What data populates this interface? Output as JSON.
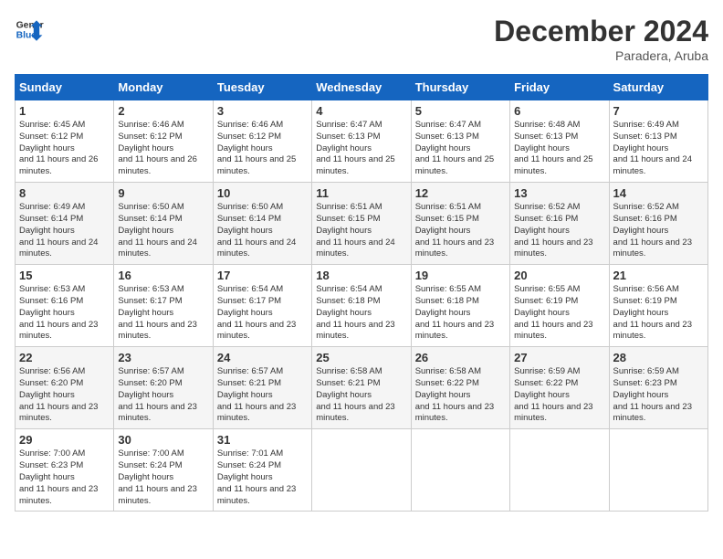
{
  "logo": {
    "line1": "General",
    "line2": "Blue"
  },
  "title": "December 2024",
  "location": "Paradera, Aruba",
  "days_of_week": [
    "Sunday",
    "Monday",
    "Tuesday",
    "Wednesday",
    "Thursday",
    "Friday",
    "Saturday"
  ],
  "weeks": [
    [
      {
        "day": "1",
        "sunrise": "6:45 AM",
        "sunset": "6:12 PM",
        "daylight": "11 hours and 26 minutes."
      },
      {
        "day": "2",
        "sunrise": "6:46 AM",
        "sunset": "6:12 PM",
        "daylight": "11 hours and 26 minutes."
      },
      {
        "day": "3",
        "sunrise": "6:46 AM",
        "sunset": "6:12 PM",
        "daylight": "11 hours and 25 minutes."
      },
      {
        "day": "4",
        "sunrise": "6:47 AM",
        "sunset": "6:13 PM",
        "daylight": "11 hours and 25 minutes."
      },
      {
        "day": "5",
        "sunrise": "6:47 AM",
        "sunset": "6:13 PM",
        "daylight": "11 hours and 25 minutes."
      },
      {
        "day": "6",
        "sunrise": "6:48 AM",
        "sunset": "6:13 PM",
        "daylight": "11 hours and 25 minutes."
      },
      {
        "day": "7",
        "sunrise": "6:49 AM",
        "sunset": "6:13 PM",
        "daylight": "11 hours and 24 minutes."
      }
    ],
    [
      {
        "day": "8",
        "sunrise": "6:49 AM",
        "sunset": "6:14 PM",
        "daylight": "11 hours and 24 minutes."
      },
      {
        "day": "9",
        "sunrise": "6:50 AM",
        "sunset": "6:14 PM",
        "daylight": "11 hours and 24 minutes."
      },
      {
        "day": "10",
        "sunrise": "6:50 AM",
        "sunset": "6:14 PM",
        "daylight": "11 hours and 24 minutes."
      },
      {
        "day": "11",
        "sunrise": "6:51 AM",
        "sunset": "6:15 PM",
        "daylight": "11 hours and 24 minutes."
      },
      {
        "day": "12",
        "sunrise": "6:51 AM",
        "sunset": "6:15 PM",
        "daylight": "11 hours and 23 minutes."
      },
      {
        "day": "13",
        "sunrise": "6:52 AM",
        "sunset": "6:16 PM",
        "daylight": "11 hours and 23 minutes."
      },
      {
        "day": "14",
        "sunrise": "6:52 AM",
        "sunset": "6:16 PM",
        "daylight": "11 hours and 23 minutes."
      }
    ],
    [
      {
        "day": "15",
        "sunrise": "6:53 AM",
        "sunset": "6:16 PM",
        "daylight": "11 hours and 23 minutes."
      },
      {
        "day": "16",
        "sunrise": "6:53 AM",
        "sunset": "6:17 PM",
        "daylight": "11 hours and 23 minutes."
      },
      {
        "day": "17",
        "sunrise": "6:54 AM",
        "sunset": "6:17 PM",
        "daylight": "11 hours and 23 minutes."
      },
      {
        "day": "18",
        "sunrise": "6:54 AM",
        "sunset": "6:18 PM",
        "daylight": "11 hours and 23 minutes."
      },
      {
        "day": "19",
        "sunrise": "6:55 AM",
        "sunset": "6:18 PM",
        "daylight": "11 hours and 23 minutes."
      },
      {
        "day": "20",
        "sunrise": "6:55 AM",
        "sunset": "6:19 PM",
        "daylight": "11 hours and 23 minutes."
      },
      {
        "day": "21",
        "sunrise": "6:56 AM",
        "sunset": "6:19 PM",
        "daylight": "11 hours and 23 minutes."
      }
    ],
    [
      {
        "day": "22",
        "sunrise": "6:56 AM",
        "sunset": "6:20 PM",
        "daylight": "11 hours and 23 minutes."
      },
      {
        "day": "23",
        "sunrise": "6:57 AM",
        "sunset": "6:20 PM",
        "daylight": "11 hours and 23 minutes."
      },
      {
        "day": "24",
        "sunrise": "6:57 AM",
        "sunset": "6:21 PM",
        "daylight": "11 hours and 23 minutes."
      },
      {
        "day": "25",
        "sunrise": "6:58 AM",
        "sunset": "6:21 PM",
        "daylight": "11 hours and 23 minutes."
      },
      {
        "day": "26",
        "sunrise": "6:58 AM",
        "sunset": "6:22 PM",
        "daylight": "11 hours and 23 minutes."
      },
      {
        "day": "27",
        "sunrise": "6:59 AM",
        "sunset": "6:22 PM",
        "daylight": "11 hours and 23 minutes."
      },
      {
        "day": "28",
        "sunrise": "6:59 AM",
        "sunset": "6:23 PM",
        "daylight": "11 hours and 23 minutes."
      }
    ],
    [
      {
        "day": "29",
        "sunrise": "7:00 AM",
        "sunset": "6:23 PM",
        "daylight": "11 hours and 23 minutes."
      },
      {
        "day": "30",
        "sunrise": "7:00 AM",
        "sunset": "6:24 PM",
        "daylight": "11 hours and 23 minutes."
      },
      {
        "day": "31",
        "sunrise": "7:01 AM",
        "sunset": "6:24 PM",
        "daylight": "11 hours and 23 minutes."
      },
      null,
      null,
      null,
      null
    ]
  ]
}
